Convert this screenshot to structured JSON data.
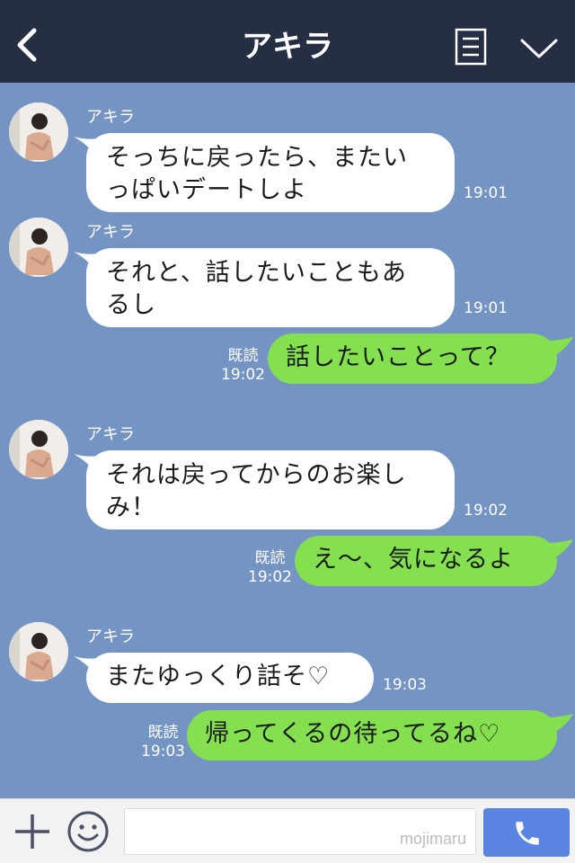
{
  "header": {
    "back_icon": "chevron-left-icon",
    "title": "アキラ",
    "menu_icon": "note-menu-icon",
    "expand_icon": "chevron-down-icon"
  },
  "messages": [
    {
      "direction": "incoming",
      "sender": "アキラ",
      "lines": [
        "そっちに戻ったら、またい",
        "っぱいデートしよ"
      ],
      "time": "19:01"
    },
    {
      "direction": "incoming",
      "sender": "アキラ",
      "lines": [
        "それと、話したいこともあ",
        "るし"
      ],
      "time": "19:01"
    },
    {
      "direction": "outgoing",
      "text": "話したいことって？",
      "read": "既読",
      "time": "19:02"
    },
    {
      "direction": "incoming",
      "sender": "アキラ",
      "lines": [
        "それは戻ってからのお楽し",
        "み！"
      ],
      "time": "19:02"
    },
    {
      "direction": "outgoing",
      "text": "え〜、気になるよ",
      "read": "既読",
      "time": "19:02"
    },
    {
      "direction": "incoming",
      "sender": "アキラ",
      "lines": [
        "またゆっくり話そ♡"
      ],
      "time": "19:03"
    },
    {
      "direction": "outgoing",
      "text": "帰ってくるの待ってるね♡",
      "read": "既読",
      "time": "19:03"
    }
  ],
  "footer": {
    "plus_icon": "plus-icon",
    "emoji_icon": "smiley-icon",
    "input_value": "",
    "watermark": "mojimaru",
    "call_icon": "phone-icon"
  },
  "colors": {
    "header_bg": "#262e43",
    "chat_bg": "#7494c4",
    "incoming_bubble": "#ffffff",
    "outgoing_bubble": "#84e04f",
    "call_button": "#5a84e2"
  }
}
